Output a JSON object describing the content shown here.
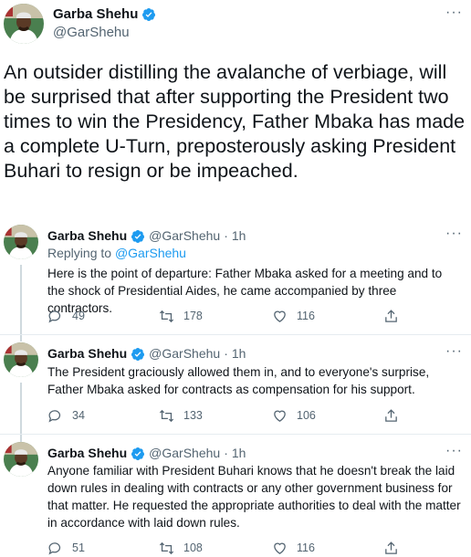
{
  "main": {
    "name": "Garba Shehu",
    "handle": "@GarShehu",
    "more": "···",
    "text": "An outsider distilling the avalanche of verbiage, will be surprised that after supporting the President two times to win the Presidency, Father Mbaka has made a complete U-Turn, preposterously asking President Buhari to resign or be impeached."
  },
  "replies": [
    {
      "name": "Garba Shehu",
      "handle": "@GarShehu",
      "dot": "·",
      "time": "1h",
      "replying_prefix": "Replying to",
      "replying_to": "@GarShehu",
      "text": "Here is the point of departure: Father Mbaka asked for a meeting and to the shock of Presidential Aides, he came accompanied by three contractors.",
      "replies": "49",
      "retweets": "178",
      "likes": "116"
    },
    {
      "name": "Garba Shehu",
      "handle": "@GarShehu",
      "dot": "·",
      "time": "1h",
      "text": "The President graciously allowed them in, and to everyone's surprise, Father Mbaka asked for contracts as compensation for his support.",
      "replies": "34",
      "retweets": "133",
      "likes": "106"
    },
    {
      "name": "Garba Shehu",
      "handle": "@GarShehu",
      "dot": "·",
      "time": "1h",
      "text": "Anyone familiar with President Buhari knows that he doesn't break the laid down rules in dealing with contracts or any other government business for that matter. He requested the appropriate authorities to deal with the matter in accordance with laid down rules.",
      "replies": "51",
      "retweets": "108",
      "likes": "116"
    }
  ],
  "icons": {
    "verified": "verified-badge-icon",
    "reply": "reply-icon",
    "retweet": "retweet-icon",
    "like": "heart-icon",
    "share": "share-icon"
  },
  "colors": {
    "accent": "#1d9bf0",
    "text": "#0f1419",
    "secondary": "#536471",
    "avatar_bg": "#3f7a4a"
  }
}
